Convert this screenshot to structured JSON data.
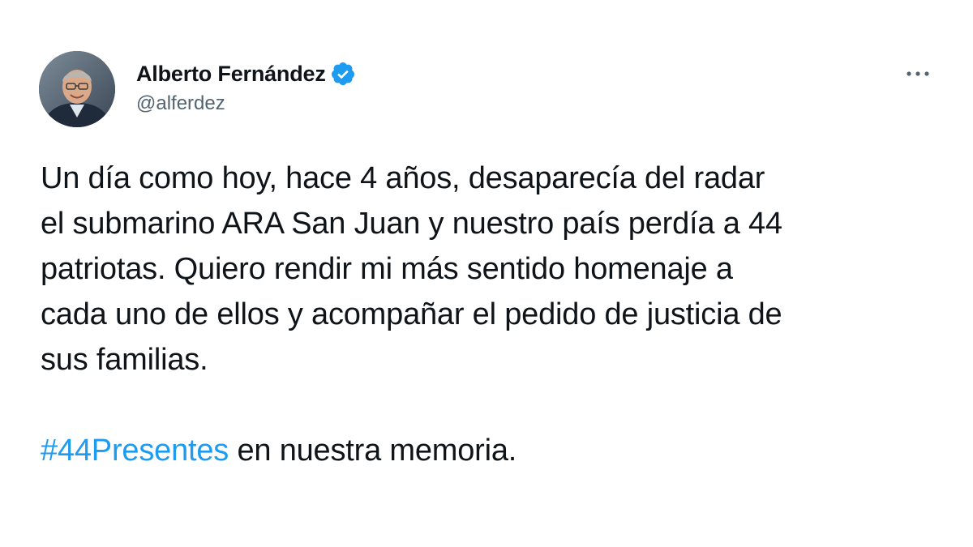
{
  "author": {
    "display_name": "Alberto Fernández",
    "handle": "@alferdez",
    "verified": true
  },
  "icons": {
    "avatar": "profile-photo",
    "verified": "verified-badge-icon",
    "more": "more-options-icon"
  },
  "tweet": {
    "lines": [
      "Un día como hoy, hace 4 años, desaparecía del radar",
      "el submarino ARA San Juan y nuestro país perdía a 44",
      "patriotas. Quiero rendir mi más sentido homenaje a",
      "cada uno de ellos y acompañar el pedido de justicia de",
      "sus familias."
    ],
    "hashtag": "#44Presentes",
    "hashtag_suffix": " en nuestra memoria."
  },
  "colors": {
    "link": "#1d9bf0",
    "text": "#0f1419",
    "secondary": "#536471"
  }
}
